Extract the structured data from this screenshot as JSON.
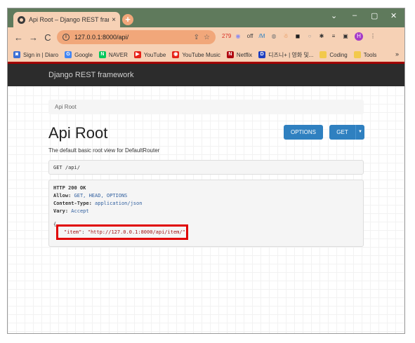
{
  "browser": {
    "tab_title": "Api Root – Django REST framew",
    "tab_close": "×",
    "new_tab": "+",
    "window_controls": [
      "⌄",
      "–",
      "▢",
      "✕"
    ],
    "nav": {
      "back": "←",
      "forward": "→",
      "reload": "C"
    },
    "url": "127.0.0.1:8000/api/",
    "address_icons": [
      "⇪",
      "☆"
    ],
    "extensions": [
      {
        "name": "gmail-279-icon",
        "label": "279",
        "color": "#d93025"
      },
      {
        "name": "globe-icon",
        "label": "◉",
        "color": "#8c8cf0"
      },
      {
        "name": "off-icon",
        "label": "off",
        "color": "#444444"
      },
      {
        "name": "mo-icon",
        "label": "/M",
        "color": "#2f80c0"
      },
      {
        "name": "shield-icon",
        "label": "◍",
        "color": "#777777"
      },
      {
        "name": "figure-icon",
        "label": "☃",
        "color": "#e07a2f"
      },
      {
        "name": "dark-ext-icon",
        "label": "◼",
        "color": "#1e1e1e"
      },
      {
        "name": "ring-icon",
        "label": "○",
        "color": "#9a9a9a"
      },
      {
        "name": "puzzle-icon",
        "label": "✱",
        "color": "#333333"
      },
      {
        "name": "queue-icon",
        "label": "≡",
        "color": "#333333"
      },
      {
        "name": "split-icon",
        "label": "▣",
        "color": "#333333"
      },
      {
        "name": "profile-icon",
        "label": "H",
        "color": "#a63ac7"
      },
      {
        "name": "menu-icon",
        "label": "⋮",
        "color": "#333333"
      }
    ],
    "bookmarks": [
      {
        "label": "Sign in | Diaro",
        "icon_color": "#3b6fd6",
        "glyph": "◙"
      },
      {
        "label": "Google",
        "icon_color": "#4285f4",
        "glyph": "G"
      },
      {
        "label": "NAVER",
        "icon_color": "#03c75a",
        "glyph": "N"
      },
      {
        "label": "YouTube",
        "icon_color": "#e62117",
        "glyph": "▶"
      },
      {
        "label": "YouTube Music",
        "icon_color": "#e62117",
        "glyph": "◉"
      },
      {
        "label": "Netflix",
        "icon_color": "#b00710",
        "glyph": "N"
      },
      {
        "label": "디즈니+ | 영화 및...",
        "icon_color": "#1f3fbf",
        "glyph": "D"
      },
      {
        "label": "Coding",
        "icon_color": "#f2c94c",
        "glyph": ""
      },
      {
        "label": "Tools",
        "icon_color": "#f2c94c",
        "glyph": ""
      }
    ],
    "bookmarks_more": "»"
  },
  "page": {
    "brand": "Django REST framework",
    "breadcrumb": "Api Root",
    "heading": "Api Root",
    "description": "The default basic root view for DefaultRouter",
    "options_button": "OPTIONS",
    "get_button": "GET",
    "get_caret": "▼",
    "request_line": "GET /api/",
    "response": {
      "status": "HTTP 200 OK",
      "allow_label": "Allow:",
      "allow_value": "GET, HEAD, OPTIONS",
      "content_type_label": "Content-Type:",
      "content_type_value": "application/json",
      "vary_label": "Vary:",
      "vary_value": "Accept",
      "open_brace": "{",
      "item_key": "\"item\"",
      "colon": ": ",
      "item_value": "\"http://127.0.0.1:8000/api/item/\""
    },
    "highlight_color": "#e00000"
  }
}
